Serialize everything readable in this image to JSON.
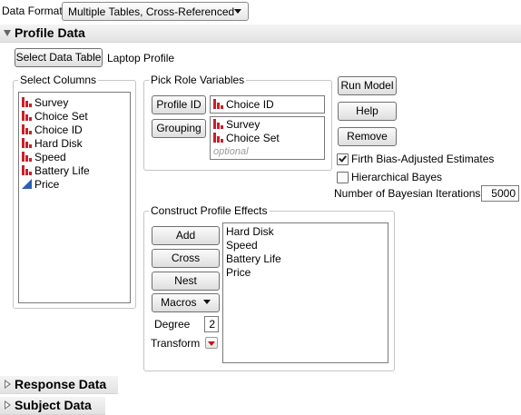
{
  "data_format": {
    "label": "Data Format",
    "value": "Multiple Tables, Cross-Referenced"
  },
  "profile_data": {
    "title": "Profile Data",
    "select_table_button": "Select Data Table",
    "table_name": "Laptop Profile"
  },
  "select_columns": {
    "title": "Select Columns",
    "items": [
      {
        "label": "Survey",
        "icon": "nominal-icon"
      },
      {
        "label": "Choice Set",
        "icon": "nominal-icon"
      },
      {
        "label": "Choice ID",
        "icon": "nominal-icon"
      },
      {
        "label": "Hard Disk",
        "icon": "nominal-icon"
      },
      {
        "label": "Speed",
        "icon": "nominal-icon"
      },
      {
        "label": "Battery Life",
        "icon": "nominal-icon"
      },
      {
        "label": "Price",
        "icon": "continuous-icon"
      }
    ]
  },
  "pick_roles": {
    "title": "Pick Role Variables",
    "profile_id_button": "Profile ID",
    "profile_id_value": "Choice ID",
    "grouping_button": "Grouping",
    "grouping_values": [
      "Survey",
      "Choice Set"
    ],
    "grouping_placeholder": "optional"
  },
  "actions": {
    "run_model": "Run Model",
    "help": "Help",
    "remove": "Remove"
  },
  "options": {
    "firth_label": "Firth Bias-Adjusted Estimates",
    "firth_checked": true,
    "hier_bayes_label": "Hierarchical Bayes",
    "hier_bayes_checked": false,
    "iterations_label": "Number of Bayesian Iterations",
    "iterations_value": "5000"
  },
  "effects": {
    "title": "Construct Profile Effects",
    "add": "Add",
    "cross": "Cross",
    "nest": "Nest",
    "macros": "Macros",
    "degree_label": "Degree",
    "degree_value": "2",
    "transform_label": "Transform",
    "items": [
      "Hard Disk",
      "Speed",
      "Battery Life",
      "Price"
    ]
  },
  "response_data": {
    "title": "Response Data"
  },
  "subject_data": {
    "title": "Subject Data"
  },
  "colors": {
    "nominal": "#c8202a",
    "continuous": "#2b5fb3",
    "transform_arrow": "#cc1111"
  }
}
